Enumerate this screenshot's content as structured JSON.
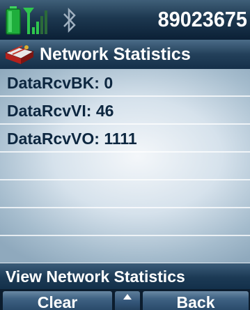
{
  "status_bar": {
    "phone_number": "89023675",
    "icons": [
      "battery-icon",
      "signal-strength-icon",
      "bluetooth-icon"
    ]
  },
  "title_bar": {
    "icon": "network-statistics-icon",
    "title": "Network Statistics"
  },
  "list": {
    "items": [
      {
        "label": "DataRcvBK: 0"
      },
      {
        "label": "DataRcvVI: 46"
      },
      {
        "label": "DataRcvVO: 1111"
      }
    ]
  },
  "footer": {
    "prompt": "View Network Statistics"
  },
  "softkeys": {
    "left_label": "Clear",
    "center_icon": "up-arrow-icon",
    "right_label": "Back"
  },
  "colors": {
    "accent_green": "#28c24a",
    "header_blue": "#1d3850",
    "text_dark": "#0d2740"
  }
}
